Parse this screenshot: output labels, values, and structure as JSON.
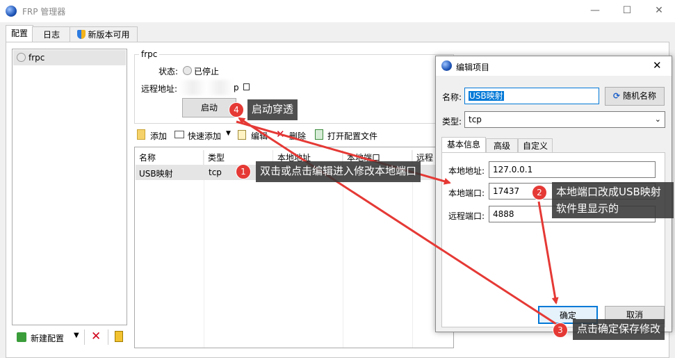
{
  "window": {
    "title": "FRP 管理器",
    "minimize": "—",
    "maximize": "☐",
    "close": "✕"
  },
  "tabs": [
    "配置",
    "日志",
    "新版本可用"
  ],
  "sidebar": {
    "items": [
      {
        "label": "frpc"
      }
    ],
    "new_config_label": "新建配置"
  },
  "group": {
    "title": "frpc",
    "status_label": "状态:",
    "status_value": "已停止",
    "remote_label": "远程地址:",
    "remote_value_suffix": "p",
    "start_button": "启动"
  },
  "toolbar": {
    "add": "添加",
    "quick_add": "快速添加",
    "edit": "编辑",
    "delete": "删除",
    "open_file": "打开配置文件"
  },
  "table": {
    "headers": [
      "名称",
      "类型",
      "本地地址",
      "本地端口",
      "远程"
    ],
    "rows": [
      {
        "name": "USB映射",
        "type": "tcp"
      }
    ]
  },
  "dialog": {
    "title": "编辑项目",
    "name_label": "名称:",
    "name_value": "USB映射",
    "random_name_button": "随机名称",
    "type_label": "类型:",
    "type_value": "tcp",
    "tabs": [
      "基本信息",
      "高级",
      "自定义"
    ],
    "local_addr_label": "本地地址:",
    "local_addr_value": "127.0.0.1",
    "local_port_label": "本地端口:",
    "local_port_value": "17437",
    "remote_port_label": "远程端口:",
    "remote_port_value": "4888",
    "ok_button": "确定",
    "cancel_button": "取消"
  },
  "annotations": [
    {
      "num": "1",
      "text": "双击或点击编辑进入修改本地端口"
    },
    {
      "num": "2",
      "text": "本地端口改成USB映射",
      "text2": "软件里显示的"
    },
    {
      "num": "3",
      "text": "点击确定保存修改"
    },
    {
      "num": "4",
      "text": "启动穿透"
    }
  ],
  "colors": {
    "accent": "#0078d7",
    "annotation_red": "#e53935",
    "callout_bg": "#373737"
  }
}
